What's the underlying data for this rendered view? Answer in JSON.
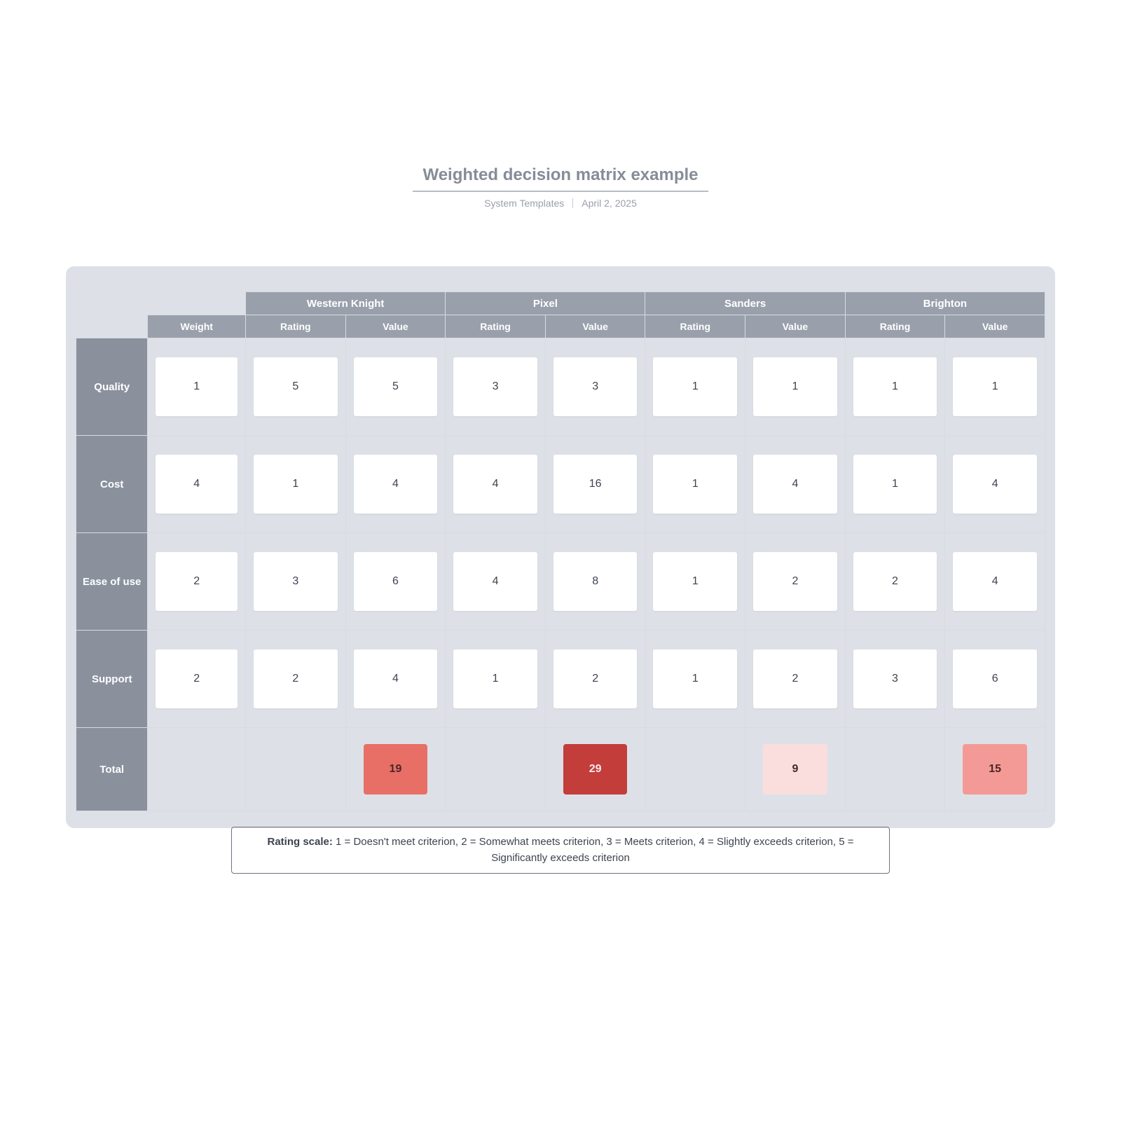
{
  "header": {
    "title": "Weighted decision matrix example",
    "author": "System Templates",
    "date": "April 2, 2025"
  },
  "matrix": {
    "weight_label": "Weight",
    "rating_label": "Rating",
    "value_label": "Value",
    "total_label": "Total",
    "options": [
      "Western Knight",
      "Pixel",
      "Sanders",
      "Brighton"
    ],
    "criteria": [
      {
        "name": "Quality",
        "weight": 1
      },
      {
        "name": "Cost",
        "weight": 4
      },
      {
        "name": "Ease of use",
        "weight": 2
      },
      {
        "name": "Support",
        "weight": 2
      }
    ],
    "values": {
      "Western Knight": {
        "ratings": [
          5,
          1,
          3,
          2
        ],
        "values": [
          5,
          4,
          6,
          4
        ],
        "total": 19
      },
      "Pixel": {
        "ratings": [
          3,
          4,
          4,
          1
        ],
        "values": [
          3,
          16,
          8,
          2
        ],
        "total": 29
      },
      "Sanders": {
        "ratings": [
          1,
          1,
          1,
          1
        ],
        "values": [
          1,
          4,
          2,
          2
        ],
        "total": 9
      },
      "Brighton": {
        "ratings": [
          1,
          1,
          2,
          3
        ],
        "values": [
          1,
          4,
          4,
          6
        ],
        "total": 15
      }
    },
    "total_colors": {
      "Western Knight": "#e86f66",
      "Pixel": "#c33d3a",
      "Sanders": "#fadedd",
      "Brighton": "#f49a96"
    }
  },
  "legend": {
    "label": "Rating scale:",
    "text": " 1 = Doesn't meet criterion, 2 = Somewhat meets criterion, 3 = Meets criterion, 4 = Slightly exceeds criterion, 5 = Significantly exceeds criterion"
  }
}
